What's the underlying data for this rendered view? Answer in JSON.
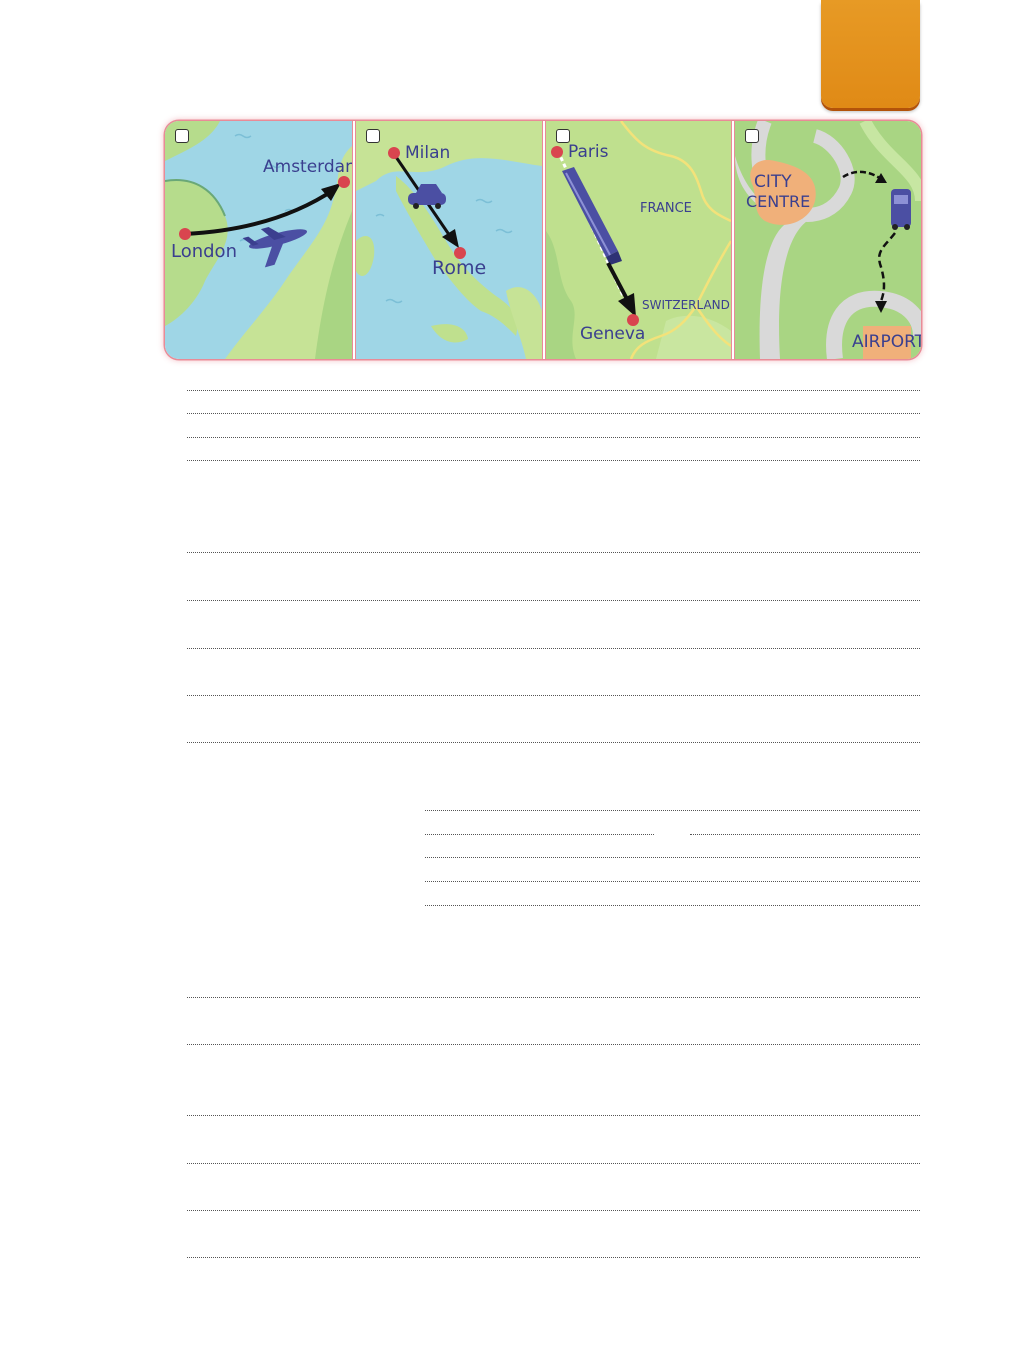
{
  "maps": {
    "panel1": {
      "from": "London",
      "to": "Amsterdam"
    },
    "panel2": {
      "from": "Milan",
      "to": "Rome"
    },
    "panel3": {
      "from": "Paris",
      "to": "Geneva",
      "country_a": "FRANCE",
      "country_b": "SWITZERLAND"
    },
    "panel4": {
      "from_line1": "CITY",
      "from_line2": "CENTRE",
      "to": "AIRPORT"
    }
  },
  "colors": {
    "tab": "#e38f1c",
    "sea": "#8fd0e0",
    "land": "#bfe08e",
    "route_dot": "#d9454f",
    "label": "#3a3f8f"
  },
  "icons": [
    "plane-icon",
    "car-icon",
    "train-icon",
    "bus-icon"
  ]
}
